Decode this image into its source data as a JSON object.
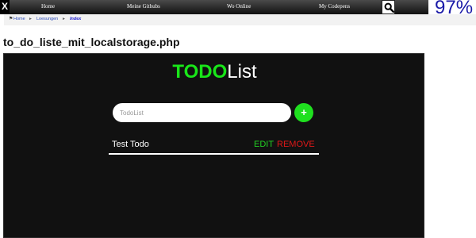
{
  "nav": {
    "close_label": "X",
    "links": [
      "Home",
      "Meine Githubs",
      "Wo Online",
      "My Codepens"
    ],
    "search_icon": "search-icon",
    "percent_text": "97%"
  },
  "breadcrumb": {
    "home_icon": "home-icon",
    "items": [
      "Home",
      "Loesungen",
      "Index"
    ]
  },
  "page_title": "to_do_liste_mit_localstorage.php",
  "app": {
    "title_highlight": "TODO",
    "title_rest": "List",
    "input_placeholder": "TodoList",
    "add_label": "+",
    "todos": [
      {
        "text": "Test Todo",
        "edit_label": "EDIT",
        "remove_label": "REMOVE"
      }
    ]
  },
  "colors": {
    "accent_green": "#1fe01f",
    "remove_red": "#e01818",
    "panel_bg": "#111111",
    "percent_blue": "#1a1aa8"
  }
}
